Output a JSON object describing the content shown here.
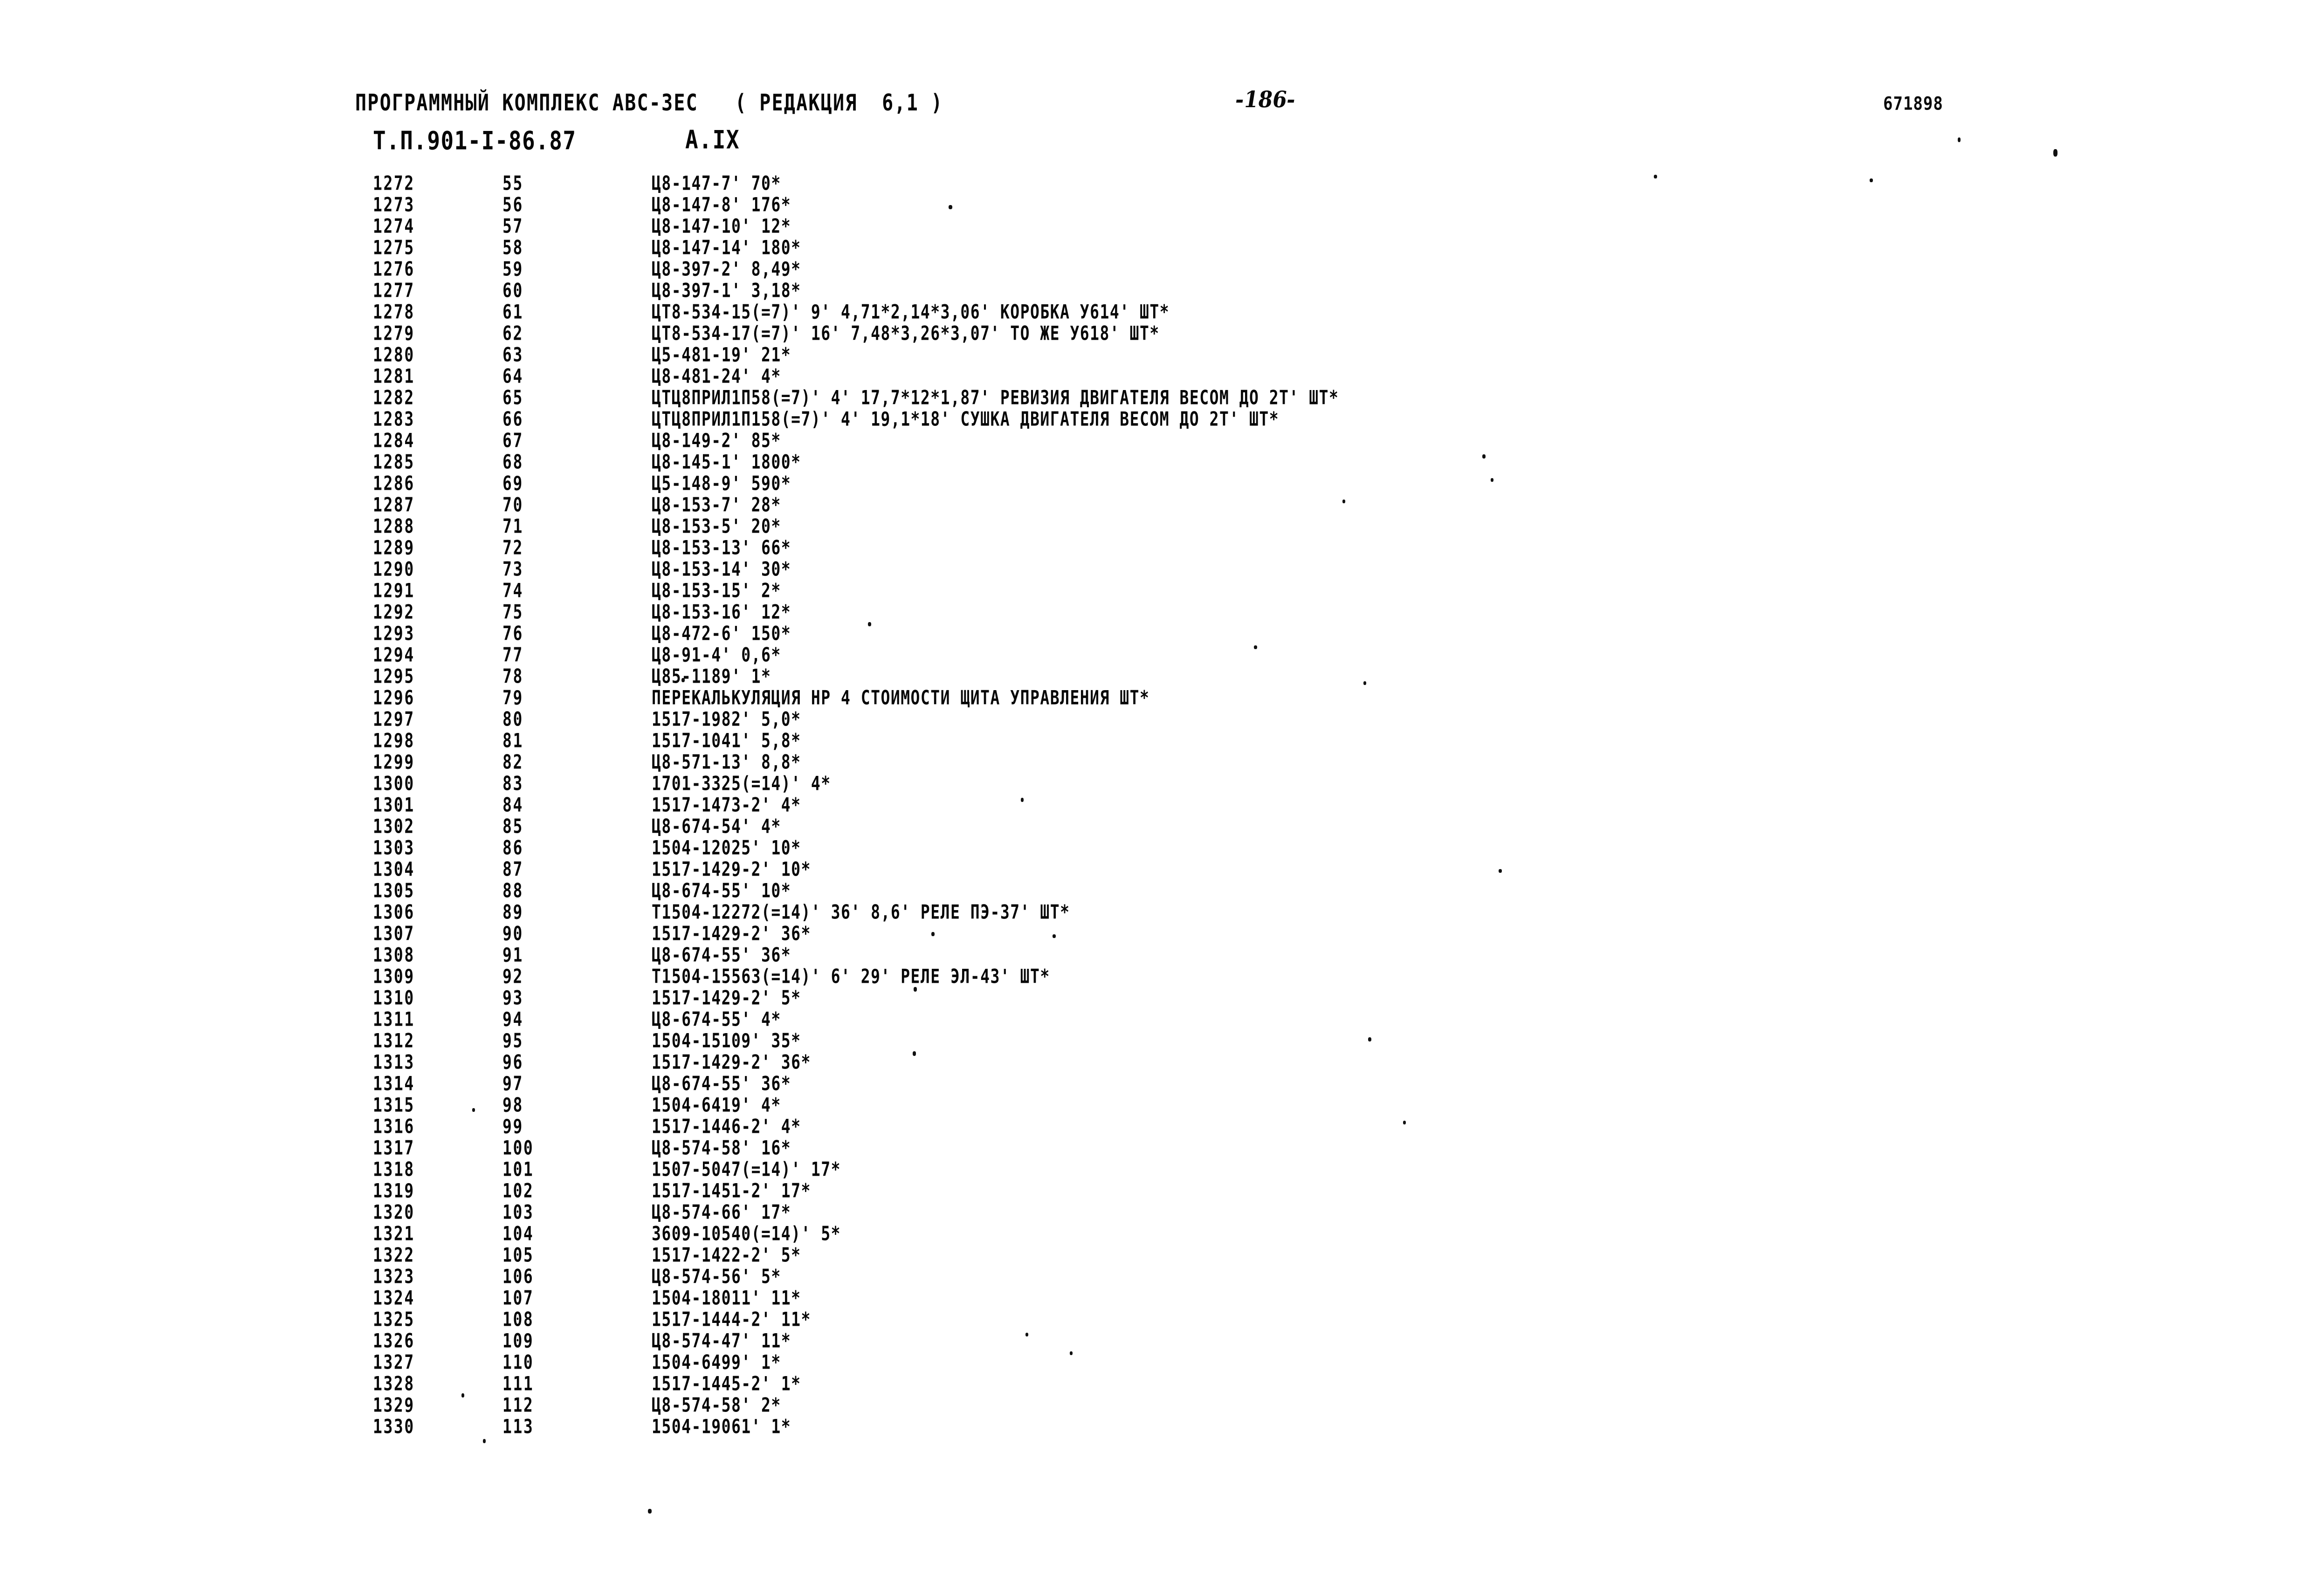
{
  "header": {
    "program_title": "ПРОГРАММНЫЙ КОМПЛЕКС АВС-ЗЕС   ( РЕДАКЦИЯ  6,1 )",
    "document_code": "Т.П.901-I-86.87",
    "appendix": "А.IX",
    "page_number": "-186-",
    "right_code": "671898"
  },
  "listing": {
    "rows": [
      {
        "seq": "1272",
        "idx": "55",
        "text": "Ц8-147-7' 70*"
      },
      {
        "seq": "1273",
        "idx": "56",
        "text": "Ц8-147-8' 176*"
      },
      {
        "seq": "1274",
        "idx": "57",
        "text": "Ц8-147-10' 12*"
      },
      {
        "seq": "1275",
        "idx": "58",
        "text": "Ц8-147-14' 180*"
      },
      {
        "seq": "1276",
        "idx": "59",
        "text": "Ц8-397-2' 8,49*"
      },
      {
        "seq": "1277",
        "idx": "60",
        "text": "Ц8-397-1' 3,18*"
      },
      {
        "seq": "1278",
        "idx": "61",
        "text": "ЦТ8-534-15(=7)' 9' 4,71*2,14*3,06' КОРОБКА У614' ШТ*"
      },
      {
        "seq": "1279",
        "idx": "62",
        "text": "ЦТ8-534-17(=7)' 16' 7,48*3,26*3,07' ТО ЖЕ У618' ШТ*"
      },
      {
        "seq": "1280",
        "idx": "63",
        "text": "Ц5-481-19' 21*"
      },
      {
        "seq": "1281",
        "idx": "64",
        "text": "Ц8-481-24' 4*"
      },
      {
        "seq": "1282",
        "idx": "65",
        "text": "ЦТЦ8ПРИЛ1П58(=7)' 4' 17,7*12*1,87' РЕВИЗИЯ ДВИГАТЕЛЯ ВЕСОМ ДО 2Т' ШТ*"
      },
      {
        "seq": "1283",
        "idx": "66",
        "text": "ЦТЦ8ПРИЛ1П158(=7)' 4' 19,1*18' СУШКА ДВИГАТЕЛЯ ВЕСОМ ДО 2Т' ШТ*"
      },
      {
        "seq": "1284",
        "idx": "67",
        "text": "Ц8-149-2' 85*"
      },
      {
        "seq": "1285",
        "idx": "68",
        "text": "Ц8-145-1' 1800*"
      },
      {
        "seq": "1286",
        "idx": "69",
        "text": "Ц5-148-9' 590*"
      },
      {
        "seq": "1287",
        "idx": "70",
        "text": "Ц8-153-7' 28*"
      },
      {
        "seq": "1288",
        "idx": "71",
        "text": "Ц8-153-5' 20*"
      },
      {
        "seq": "1289",
        "idx": "72",
        "text": "Ц8-153-13' 66*"
      },
      {
        "seq": "1290",
        "idx": "73",
        "text": "Ц8-153-14' 30*"
      },
      {
        "seq": "1291",
        "idx": "74",
        "text": "Ц8-153-15' 2*"
      },
      {
        "seq": "1292",
        "idx": "75",
        "text": "Ц8-153-16' 12*"
      },
      {
        "seq": "1293",
        "idx": "76",
        "text": "Ц8-472-6' 150*"
      },
      {
        "seq": "1294",
        "idx": "77",
        "text": "Ц8-91-4' 0,6*"
      },
      {
        "seq": "1295",
        "idx": "78",
        "text": "Ц85-1189' 1*"
      },
      {
        "seq": "1296",
        "idx": "79",
        "text": "ПЕРЕКАЛЬКУЛЯЦИЯ НР 4 СТОИМОСТИ ЩИТА УПРАВЛЕНИЯ ШТ*"
      },
      {
        "seq": "1297",
        "idx": "80",
        "text": "1517-1982' 5,0*"
      },
      {
        "seq": "1298",
        "idx": "81",
        "text": "1517-1041' 5,8*"
      },
      {
        "seq": "1299",
        "idx": "82",
        "text": "Ц8-571-13' 8,8*"
      },
      {
        "seq": "1300",
        "idx": "83",
        "text": "1701-3325(=14)' 4*"
      },
      {
        "seq": "1301",
        "idx": "84",
        "text": "1517-1473-2' 4*"
      },
      {
        "seq": "1302",
        "idx": "85",
        "text": "Ц8-674-54' 4*"
      },
      {
        "seq": "1303",
        "idx": "86",
        "text": "1504-12025' 10*"
      },
      {
        "seq": "1304",
        "idx": "87",
        "text": "1517-1429-2' 10*"
      },
      {
        "seq": "1305",
        "idx": "88",
        "text": "Ц8-674-55' 10*"
      },
      {
        "seq": "1306",
        "idx": "89",
        "text": "Т1504-12272(=14)' 36' 8,6' РЕЛЕ ПЭ-37' ШТ*"
      },
      {
        "seq": "1307",
        "idx": "90",
        "text": "1517-1429-2' 36*"
      },
      {
        "seq": "1308",
        "idx": "91",
        "text": "Ц8-674-55' 36*"
      },
      {
        "seq": "1309",
        "idx": "92",
        "text": "Т1504-15563(=14)' 6' 29' РЕЛЕ ЭЛ-43' ШТ*"
      },
      {
        "seq": "1310",
        "idx": "93",
        "text": "1517-1429-2' 5*"
      },
      {
        "seq": "1311",
        "idx": "94",
        "text": "Ц8-674-55' 4*"
      },
      {
        "seq": "1312",
        "idx": "95",
        "text": "1504-15109' 35*"
      },
      {
        "seq": "1313",
        "idx": "96",
        "text": "1517-1429-2' 36*"
      },
      {
        "seq": "1314",
        "idx": "97",
        "text": "Ц8-674-55' 36*"
      },
      {
        "seq": "1315",
        "idx": "98",
        "text": "1504-6419' 4*"
      },
      {
        "seq": "1316",
        "idx": "99",
        "text": "1517-1446-2' 4*"
      },
      {
        "seq": "1317",
        "idx": "100",
        "text": "Ц8-574-58' 16*"
      },
      {
        "seq": "1318",
        "idx": "101",
        "text": "1507-5047(=14)' 17*"
      },
      {
        "seq": "1319",
        "idx": "102",
        "text": "1517-1451-2' 17*"
      },
      {
        "seq": "1320",
        "idx": "103",
        "text": "Ц8-574-66' 17*"
      },
      {
        "seq": "1321",
        "idx": "104",
        "text": "3609-10540(=14)' 5*"
      },
      {
        "seq": "1322",
        "idx": "105",
        "text": "1517-1422-2' 5*"
      },
      {
        "seq": "1323",
        "idx": "106",
        "text": "Ц8-574-56' 5*"
      },
      {
        "seq": "1324",
        "idx": "107",
        "text": "1504-18011' 11*"
      },
      {
        "seq": "1325",
        "idx": "108",
        "text": "1517-1444-2' 11*"
      },
      {
        "seq": "1326",
        "idx": "109",
        "text": "Ц8-574-47' 11*"
      },
      {
        "seq": "1327",
        "idx": "110",
        "text": "1504-6499' 1*"
      },
      {
        "seq": "1328",
        "idx": "111",
        "text": "1517-1445-2' 1*"
      },
      {
        "seq": "1329",
        "idx": "112",
        "text": "Ц8-574-58' 2*"
      },
      {
        "seq": "1330",
        "idx": "113",
        "text": "1504-19061' 1*"
      }
    ]
  }
}
